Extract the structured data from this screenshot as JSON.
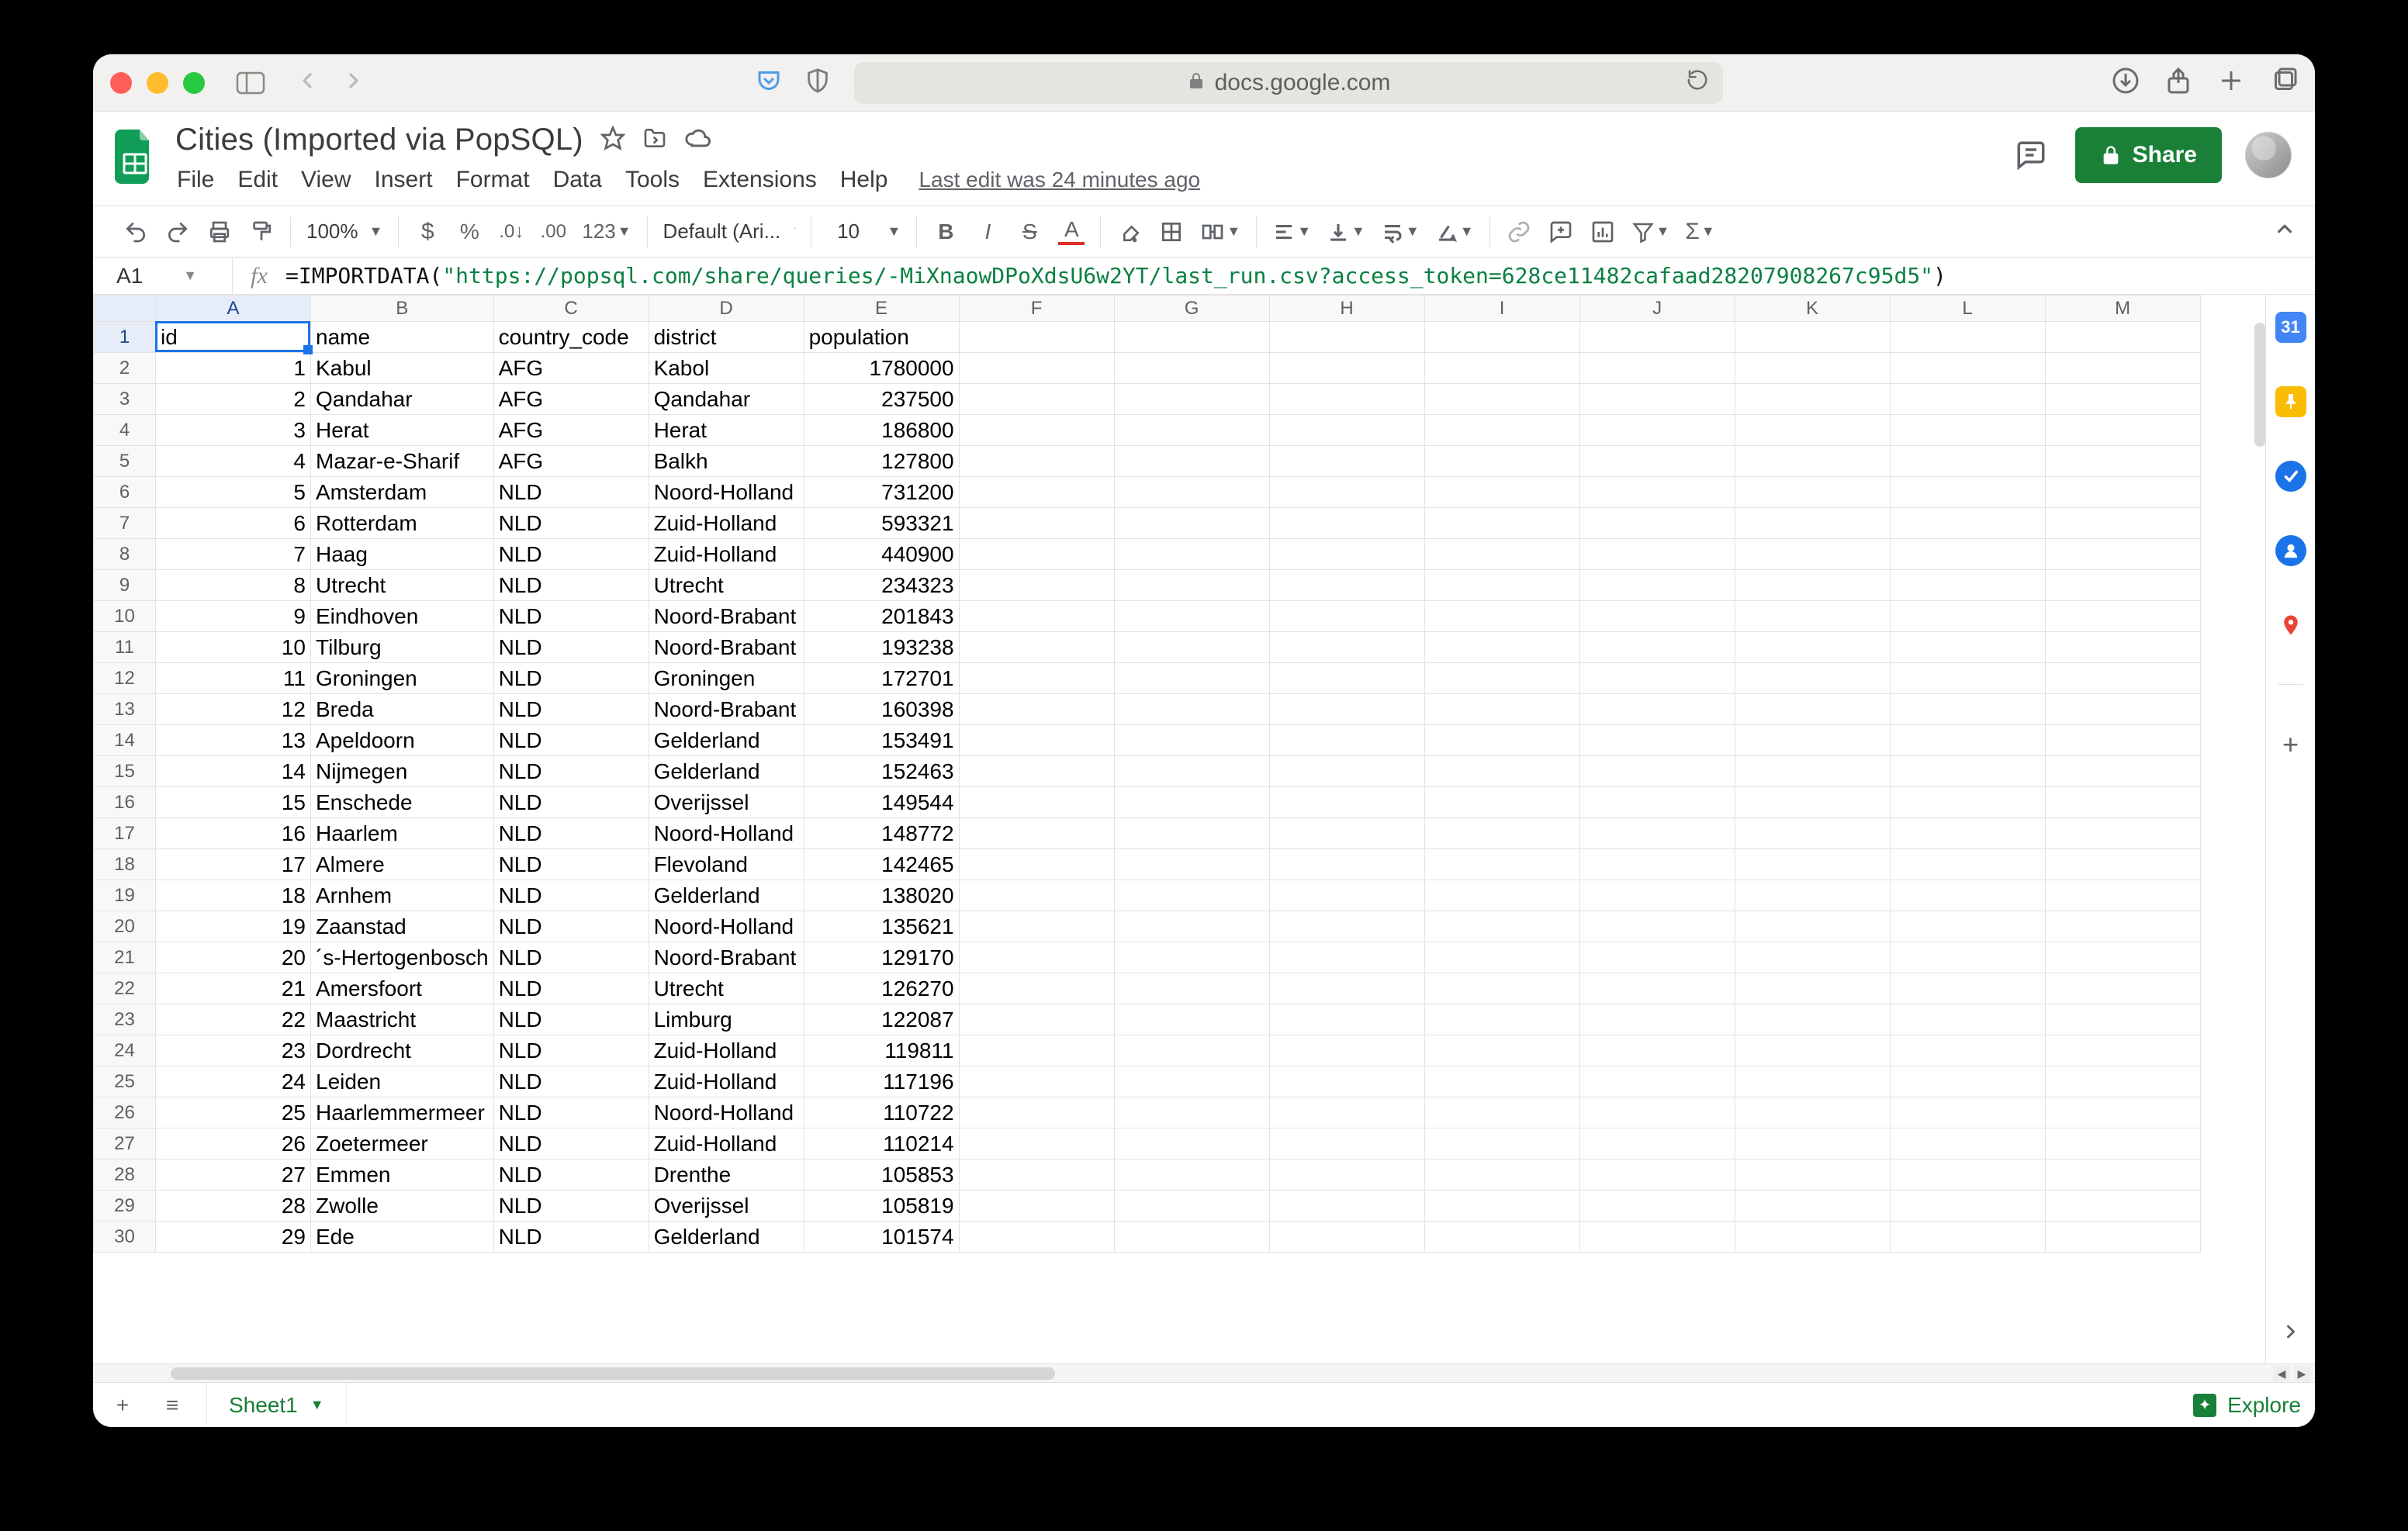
{
  "browser": {
    "url_host": "docs.google.com"
  },
  "doc": {
    "title": "Cities (Imported via PopSQL)",
    "last_edit": "Last edit was 24 minutes ago"
  },
  "menus": [
    "File",
    "Edit",
    "View",
    "Insert",
    "Format",
    "Data",
    "Tools",
    "Extensions",
    "Help"
  ],
  "toolbar": {
    "zoom": "100%",
    "font": "Default (Ari...",
    "font_size": "10"
  },
  "share_label": "Share",
  "namebox": "A1",
  "formula": {
    "prefix": "=IMPORTDATA(",
    "arg": "\"https://popsql.com/share/queries/-MiXnaowDPoXdsU6w2YT/last_run.csv?access_token=628ce11482cafaad28207908267c95d5\"",
    "suffix": ")"
  },
  "columns": [
    "A",
    "B",
    "C",
    "D",
    "E",
    "F",
    "G",
    "H",
    "I",
    "J",
    "K",
    "L",
    "M"
  ],
  "headers": [
    "id",
    "name",
    "country_code",
    "district",
    "population"
  ],
  "rows": [
    {
      "n": 1,
      "id": 1,
      "name": "Kabul",
      "cc": "AFG",
      "district": "Kabol",
      "pop": 1780000
    },
    {
      "n": 2,
      "id": 2,
      "name": "Qandahar",
      "cc": "AFG",
      "district": "Qandahar",
      "pop": 237500
    },
    {
      "n": 3,
      "id": 3,
      "name": "Herat",
      "cc": "AFG",
      "district": "Herat",
      "pop": 186800
    },
    {
      "n": 4,
      "id": 4,
      "name": "Mazar-e-Sharif",
      "cc": "AFG",
      "district": "Balkh",
      "pop": 127800
    },
    {
      "n": 5,
      "id": 5,
      "name": "Amsterdam",
      "cc": "NLD",
      "district": "Noord-Holland",
      "pop": 731200
    },
    {
      "n": 6,
      "id": 6,
      "name": "Rotterdam",
      "cc": "NLD",
      "district": "Zuid-Holland",
      "pop": 593321
    },
    {
      "n": 7,
      "id": 7,
      "name": "Haag",
      "cc": "NLD",
      "district": "Zuid-Holland",
      "pop": 440900
    },
    {
      "n": 8,
      "id": 8,
      "name": "Utrecht",
      "cc": "NLD",
      "district": "Utrecht",
      "pop": 234323
    },
    {
      "n": 9,
      "id": 9,
      "name": "Eindhoven",
      "cc": "NLD",
      "district": "Noord-Brabant",
      "pop": 201843
    },
    {
      "n": 10,
      "id": 10,
      "name": "Tilburg",
      "cc": "NLD",
      "district": "Noord-Brabant",
      "pop": 193238
    },
    {
      "n": 11,
      "id": 11,
      "name": "Groningen",
      "cc": "NLD",
      "district": "Groningen",
      "pop": 172701
    },
    {
      "n": 12,
      "id": 12,
      "name": "Breda",
      "cc": "NLD",
      "district": "Noord-Brabant",
      "pop": 160398
    },
    {
      "n": 13,
      "id": 13,
      "name": "Apeldoorn",
      "cc": "NLD",
      "district": "Gelderland",
      "pop": 153491
    },
    {
      "n": 14,
      "id": 14,
      "name": "Nijmegen",
      "cc": "NLD",
      "district": "Gelderland",
      "pop": 152463
    },
    {
      "n": 15,
      "id": 15,
      "name": "Enschede",
      "cc": "NLD",
      "district": "Overijssel",
      "pop": 149544
    },
    {
      "n": 16,
      "id": 16,
      "name": "Haarlem",
      "cc": "NLD",
      "district": "Noord-Holland",
      "pop": 148772
    },
    {
      "n": 17,
      "id": 17,
      "name": "Almere",
      "cc": "NLD",
      "district": "Flevoland",
      "pop": 142465
    },
    {
      "n": 18,
      "id": 18,
      "name": "Arnhem",
      "cc": "NLD",
      "district": "Gelderland",
      "pop": 138020
    },
    {
      "n": 19,
      "id": 19,
      "name": "Zaanstad",
      "cc": "NLD",
      "district": "Noord-Holland",
      "pop": 135621
    },
    {
      "n": 20,
      "id": 20,
      "name": "´s-Hertogenbosch",
      "cc": "NLD",
      "district": "Noord-Brabant",
      "pop": 129170
    },
    {
      "n": 21,
      "id": 21,
      "name": "Amersfoort",
      "cc": "NLD",
      "district": "Utrecht",
      "pop": 126270
    },
    {
      "n": 22,
      "id": 22,
      "name": "Maastricht",
      "cc": "NLD",
      "district": "Limburg",
      "pop": 122087
    },
    {
      "n": 23,
      "id": 23,
      "name": "Dordrecht",
      "cc": "NLD",
      "district": "Zuid-Holland",
      "pop": 119811
    },
    {
      "n": 24,
      "id": 24,
      "name": "Leiden",
      "cc": "NLD",
      "district": "Zuid-Holland",
      "pop": 117196
    },
    {
      "n": 25,
      "id": 25,
      "name": "Haarlemmermeer",
      "cc": "NLD",
      "district": "Noord-Holland",
      "pop": 110722
    },
    {
      "n": 26,
      "id": 26,
      "name": "Zoetermeer",
      "cc": "NLD",
      "district": "Zuid-Holland",
      "pop": 110214
    },
    {
      "n": 27,
      "id": 27,
      "name": "Emmen",
      "cc": "NLD",
      "district": "Drenthe",
      "pop": 105853
    },
    {
      "n": 28,
      "id": 28,
      "name": "Zwolle",
      "cc": "NLD",
      "district": "Overijssel",
      "pop": 105819
    },
    {
      "n": 29,
      "id": 29,
      "name": "Ede",
      "cc": "NLD",
      "district": "Gelderland",
      "pop": 101574
    }
  ],
  "sheet_tab": "Sheet1",
  "explore_label": "Explore"
}
